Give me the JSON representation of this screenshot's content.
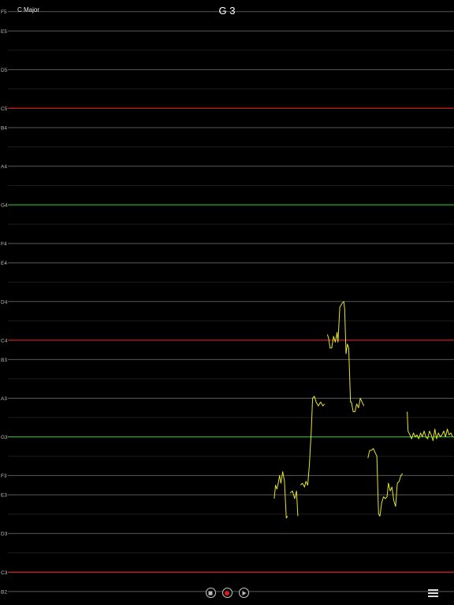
{
  "header": {
    "key_label": "C Major",
    "current_note": "G 3"
  },
  "colors": {
    "background": "#000000",
    "grid_minor": "#1c1c1c",
    "grid_note": "#5a5a5a",
    "tonic_line": "#c81e1e",
    "dominant_line": "#2eb82e",
    "pitch_trace": "#e6e62e"
  },
  "chart_data": {
    "type": "line",
    "title": "",
    "xlabel": "",
    "ylabel": "",
    "note_labels": [
      "F5",
      "E5",
      "D5",
      "C5",
      "B4",
      "A4",
      "G4",
      "F4",
      "E4",
      "D4",
      "C4",
      "B3",
      "A3",
      "G3",
      "F3",
      "E3",
      "D3",
      "C3",
      "B2"
    ],
    "note_semitones": [
      77,
      76,
      74,
      72,
      71,
      69,
      67,
      65,
      64,
      62,
      60,
      59,
      57,
      55,
      53,
      52,
      50,
      48,
      47
    ],
    "tonic_notes": [
      "C5",
      "C4",
      "C3"
    ],
    "dominant_notes": [
      "G4",
      "G3"
    ],
    "ylim_semitones": [
      46.3,
      77.6
    ],
    "xlim": [
      0,
      100
    ],
    "series": [
      {
        "segments": [
          [
            [
              59.7,
              51.8
            ],
            [
              60.0,
              52.5
            ],
            [
              60.3,
              52.3
            ],
            [
              60.6,
              52.6
            ],
            [
              60.9,
              53.0
            ],
            [
              61.2,
              52.6
            ],
            [
              61.6,
              53.2
            ],
            [
              62.0,
              52.7
            ],
            [
              62.4,
              50.8
            ],
            [
              62.7,
              50.9
            ]
          ],
          [
            [
              63.3,
              52.1
            ],
            [
              63.8,
              52.2
            ],
            [
              64.3,
              51.8
            ],
            [
              64.7,
              52.2
            ],
            [
              65.0,
              50.9
            ]
          ],
          [
            [
              65.6,
              52.5
            ],
            [
              66.0,
              52.6
            ],
            [
              66.5,
              52.4
            ],
            [
              66.8,
              52.7
            ],
            [
              67.2,
              52.5
            ],
            [
              67.6,
              53.6
            ],
            [
              68.0,
              55.3
            ],
            [
              68.3,
              57.0
            ],
            [
              68.7,
              57.1
            ],
            [
              69.1,
              56.8
            ],
            [
              69.6,
              56.6
            ],
            [
              70.1,
              56.8
            ],
            [
              70.6,
              56.6
            ],
            [
              71.0,
              56.7
            ]
          ],
          [
            [
              71.6,
              60.3
            ],
            [
              71.9,
              60.1
            ],
            [
              72.2,
              59.6
            ],
            [
              72.6,
              59.6
            ],
            [
              73.0,
              60.2
            ],
            [
              73.4,
              59.9
            ],
            [
              73.8,
              60.4
            ],
            [
              74.0,
              59.9
            ],
            [
              74.4,
              61.7
            ],
            [
              74.9,
              61.9
            ],
            [
              75.3,
              62.0
            ],
            [
              75.5,
              61.6
            ],
            [
              75.8,
              59.3
            ],
            [
              76.1,
              59.8
            ],
            [
              76.4,
              59.6
            ],
            [
              76.8,
              56.8
            ],
            [
              77.0,
              56.8
            ],
            [
              77.4,
              56.3
            ],
            [
              77.8,
              56.3
            ],
            [
              78.2,
              56.7
            ],
            [
              78.6,
              56.5
            ],
            [
              79.0,
              57.0
            ],
            [
              79.4,
              56.8
            ],
            [
              79.8,
              56.6
            ]
          ],
          [
            [
              80.7,
              53.9
            ],
            [
              81.1,
              54.3
            ],
            [
              81.5,
              54.3
            ],
            [
              81.9,
              54.4
            ],
            [
              82.3,
              54.2
            ],
            [
              82.7,
              54.0
            ],
            [
              83.1,
              51.0
            ],
            [
              83.4,
              50.9
            ],
            [
              83.8,
              51.6
            ],
            [
              84.2,
              51.9
            ],
            [
              84.6,
              51.8
            ],
            [
              85.0,
              51.9
            ],
            [
              85.3,
              52.6
            ],
            [
              85.7,
              52.2
            ],
            [
              86.1,
              52.4
            ],
            [
              86.5,
              51.7
            ],
            [
              86.9,
              51.4
            ],
            [
              87.3,
              52.6
            ],
            [
              87.7,
              52.7
            ],
            [
              88.1,
              53.0
            ],
            [
              88.5,
              53.1
            ]
          ],
          [
            [
              89.5,
              56.3
            ],
            [
              89.7,
              55.3
            ],
            [
              90.1,
              55.1
            ],
            [
              90.5,
              54.9
            ],
            [
              90.9,
              55.2
            ],
            [
              91.3,
              55.0
            ],
            [
              91.7,
              55.1
            ],
            [
              92.1,
              54.9
            ],
            [
              92.5,
              55.2
            ],
            [
              92.9,
              55.0
            ],
            [
              93.3,
              55.3
            ],
            [
              93.7,
              55.0
            ],
            [
              94.1,
              54.9
            ],
            [
              94.5,
              55.3
            ],
            [
              94.9,
              55.1
            ],
            [
              95.3,
              54.8
            ],
            [
              95.7,
              55.4
            ],
            [
              96.1,
              54.9
            ],
            [
              96.5,
              55.2
            ],
            [
              96.9,
              55.0
            ],
            [
              97.3,
              55.1
            ],
            [
              97.7,
              55.3
            ],
            [
              98.1,
              55.0
            ],
            [
              98.5,
              55.4
            ],
            [
              98.9,
              55.1
            ],
            [
              99.3,
              55.2
            ],
            [
              99.7,
              55.0
            ]
          ]
        ]
      }
    ]
  },
  "controls": {
    "stop_icon": "stop-icon",
    "record_icon": "record-icon",
    "play_icon": "play-icon",
    "menu_icon": "hamburger-menu-icon"
  }
}
